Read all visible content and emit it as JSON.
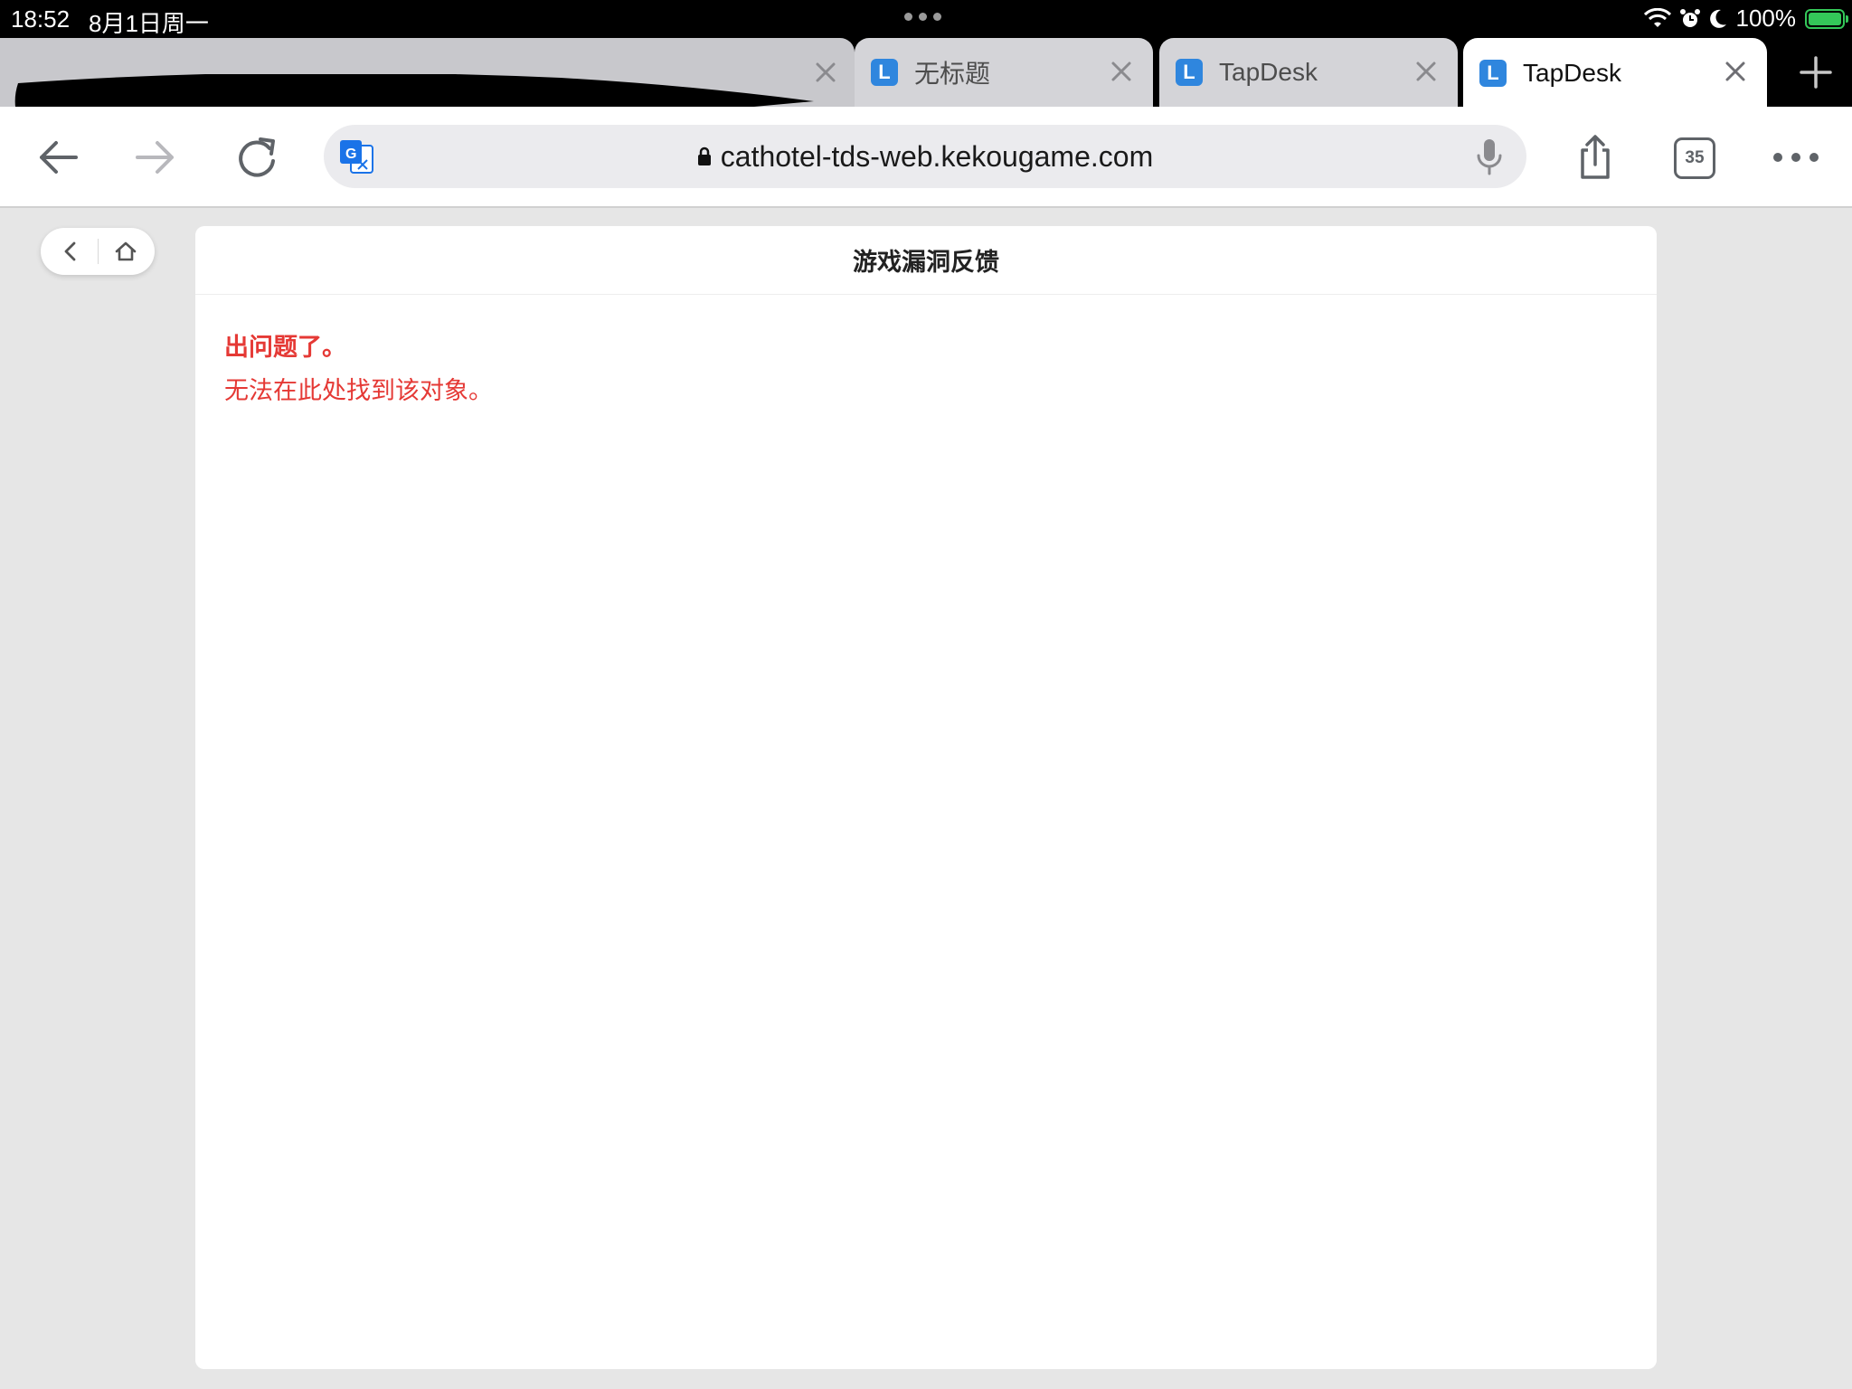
{
  "status_bar": {
    "time": "18:52",
    "date": "8月1日周一",
    "battery": "100%",
    "icons": [
      "wifi-icon",
      "alarm-icon",
      "moon-icon",
      "battery-charging-icon"
    ]
  },
  "tabs": [
    {
      "label": "",
      "redacted": true
    },
    {
      "label": "无标题",
      "favicon": "L"
    },
    {
      "label": "TapDesk",
      "favicon": "L"
    },
    {
      "label": "TapDesk",
      "favicon": "L",
      "active": true
    }
  ],
  "toolbar": {
    "url": "cathotel-tds-web.kekougame.com",
    "tab_count": "35"
  },
  "page": {
    "title": "游戏漏洞反馈",
    "error_title": "出问题了。",
    "error_message": "无法在此处找到该对象。"
  },
  "colors": {
    "error": "#e53935",
    "favicon": "#2f86de",
    "battery": "#34c759"
  }
}
